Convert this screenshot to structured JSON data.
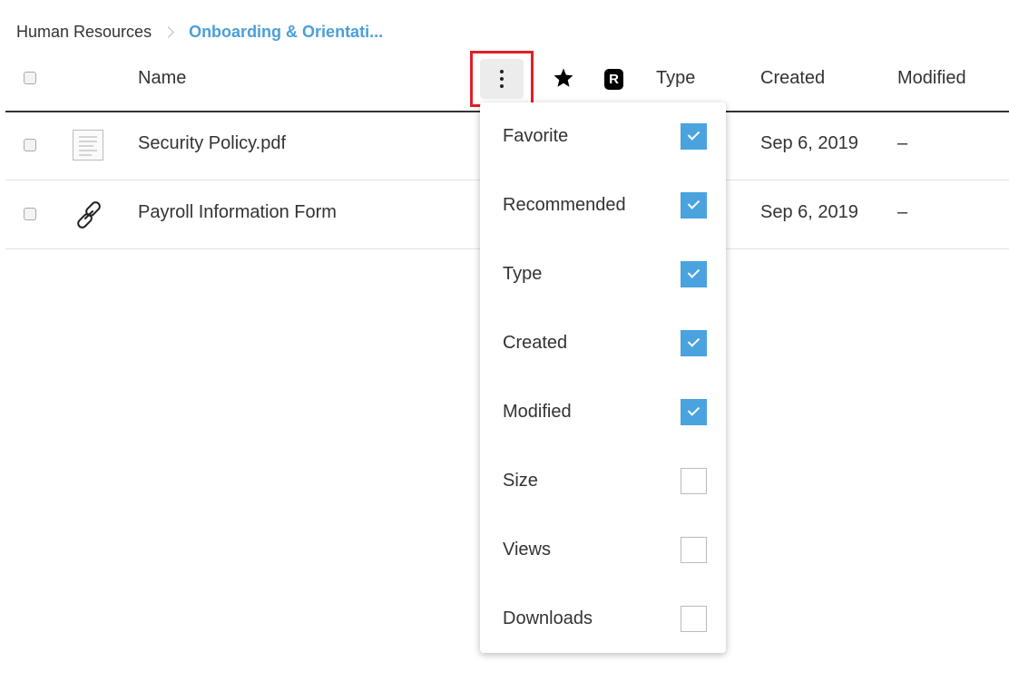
{
  "breadcrumb": {
    "root": "Human Resources",
    "current": "Onboarding & Orientati..."
  },
  "table": {
    "columns": {
      "name": "Name",
      "type": "Type",
      "created": "Created",
      "modified": "Modified",
      "recommended_badge": "R"
    },
    "rows": [
      {
        "name": "Security Policy.pdf",
        "icon": "document-icon",
        "created": "Sep 6, 2019",
        "modified": "–"
      },
      {
        "name": "Payroll Information Form",
        "icon": "link-icon",
        "created": "Sep 6, 2019",
        "modified": "–"
      }
    ]
  },
  "column_menu": {
    "items": [
      {
        "label": "Favorite",
        "checked": true
      },
      {
        "label": "Recommended",
        "checked": true
      },
      {
        "label": "Type",
        "checked": true
      },
      {
        "label": "Created",
        "checked": true
      },
      {
        "label": "Modified",
        "checked": true
      },
      {
        "label": "Size",
        "checked": false
      },
      {
        "label": "Views",
        "checked": false
      },
      {
        "label": "Downloads",
        "checked": false
      }
    ]
  },
  "colors": {
    "accent": "#4aa3df",
    "breadcrumb_link": "#4a9fd8",
    "highlight_box": "#e01f26"
  }
}
